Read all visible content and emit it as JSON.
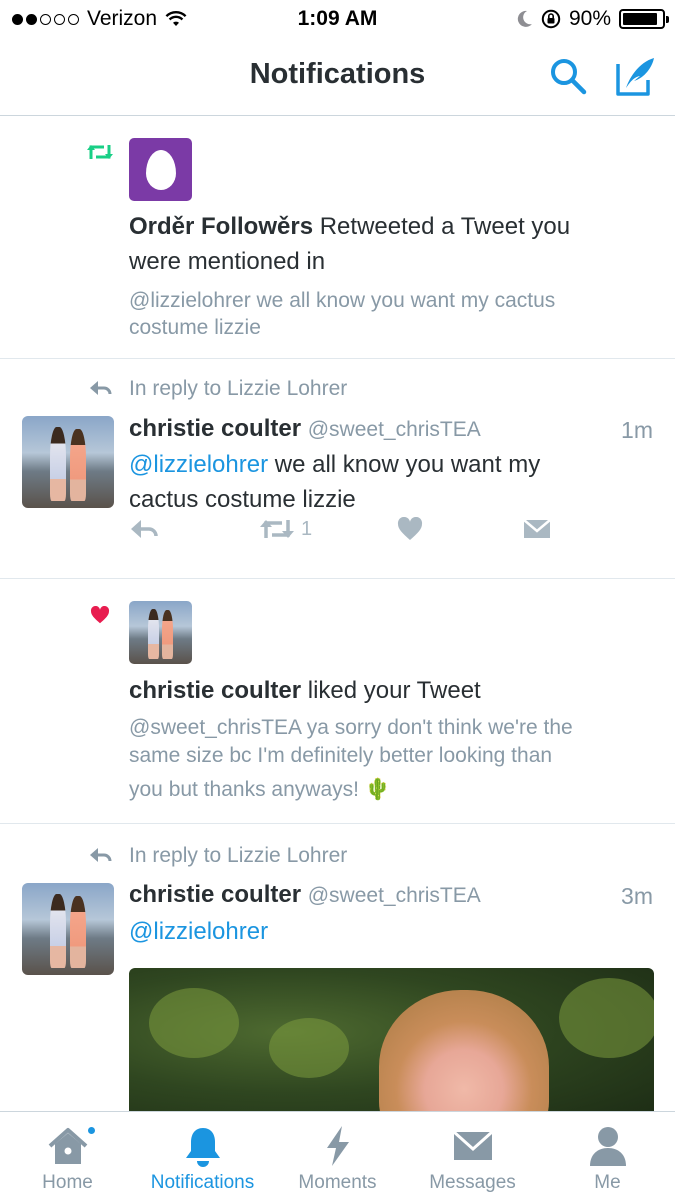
{
  "status_bar": {
    "carrier": "Verizon",
    "time": "1:09 AM",
    "battery": "90%",
    "battery_level": 0.9,
    "signal_bars": 2
  },
  "nav": {
    "title": "Notifications"
  },
  "notifications": [
    {
      "type": "retweet",
      "icon": "retweet-icon",
      "actor": "Orděr Followěrs",
      "action_text": "Retweeted a Tweet you",
      "action_text_2": "were mentioned in",
      "tweet_line_1": "@lizzielohrer we all know you want my cactus",
      "tweet_line_2": "costume lizzie"
    },
    {
      "type": "reply",
      "reply_to": "In reply to Lizzie Lohrer",
      "name": "christie coulter",
      "handle": "@sweet_chrisTEA",
      "time": "1m",
      "mention": "@lizzielohrer",
      "text_1": " we all know you want my",
      "text_2": "cactus costume lizzie",
      "retweet_count": "1"
    },
    {
      "type": "like",
      "icon": "heart-icon",
      "actor": "christie coulter",
      "action_text": "liked your Tweet",
      "tweet_line_1": "@sweet_chrisTEA ya sorry don't think we're the",
      "tweet_line_2": "same size bc I'm definitely better looking than",
      "tweet_line_3": "you but thanks anyways! 🌵"
    },
    {
      "type": "reply",
      "reply_to": "In reply to Lizzie Lohrer",
      "name": "christie coulter",
      "handle": "@sweet_chrisTEA",
      "time": "3m",
      "mention": "@lizzielohrer"
    }
  ],
  "tabs": [
    {
      "label": "Home",
      "icon": "home-icon",
      "active": false,
      "badge": true
    },
    {
      "label": "Notifications",
      "icon": "bell-icon",
      "active": true
    },
    {
      "label": "Moments",
      "icon": "lightning-icon",
      "active": false
    },
    {
      "label": "Messages",
      "icon": "envelope-icon",
      "active": false
    },
    {
      "label": "Me",
      "icon": "person-icon",
      "active": false
    }
  ],
  "colors": {
    "accent": "#1b95e0",
    "retweet_green": "#19cf86",
    "like_red": "#e81c4f",
    "text_grey": "#8899a6",
    "icon_grey": "#aab8c2"
  }
}
